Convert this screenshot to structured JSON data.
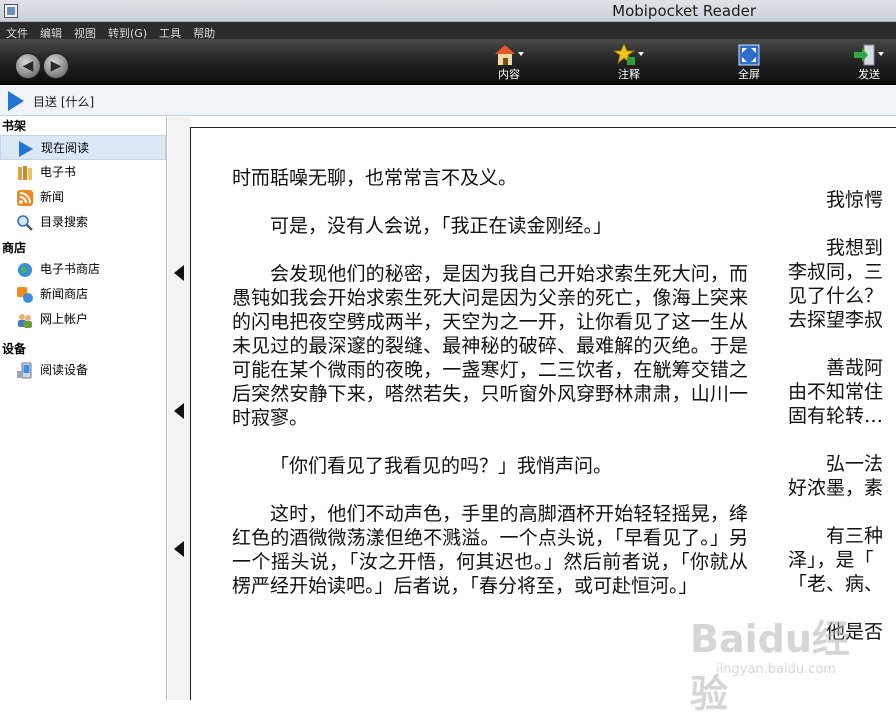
{
  "window": {
    "title": "Mobipocket Reader"
  },
  "menu": [
    "文件",
    "编辑",
    "视图",
    "转到(G)",
    "工具",
    "帮助"
  ],
  "toolbar": {
    "back_icon": "back-arrow-icon",
    "forward_icon": "forward-arrow-icon",
    "tools": [
      {
        "label": "内容",
        "icon": "home-icon"
      },
      {
        "label": "注释",
        "icon": "star-icon"
      },
      {
        "label": "全屏",
        "icon": "fullscreen-icon"
      },
      {
        "label": "发送",
        "icon": "send-icon"
      }
    ]
  },
  "breadcrumb": {
    "text": "目送 [什么]"
  },
  "sidebar": {
    "sections": [
      {
        "title": "书架",
        "items": [
          {
            "label": "现在阅读",
            "icon": "play-icon",
            "selected": true
          },
          {
            "label": "电子书",
            "icon": "books-icon"
          },
          {
            "label": "新闻",
            "icon": "rss-icon"
          },
          {
            "label": "目录搜索",
            "icon": "search-icon"
          }
        ]
      },
      {
        "title": "商店",
        "items": [
          {
            "label": "电子书商店",
            "icon": "globe-icon"
          },
          {
            "label": "新闻商店",
            "icon": "news-store-icon"
          },
          {
            "label": "网上帐户",
            "icon": "users-icon"
          }
        ]
      },
      {
        "title": "设备",
        "items": [
          {
            "label": "阅读设备",
            "icon": "device-icon"
          }
        ]
      }
    ]
  },
  "reader": {
    "column1": [
      "时而聒噪无聊，也常常言不及义。",
      "可是，没有人会说，「我正在读金刚经。」",
      "会发现他们的秘密，是因为我自己开始求索生死大问，而愚钝如我会开始求索生死大问是因为父亲的死亡，像海上突来的闪电把夜空劈成两半，天空为之一开，让你看见了这一生从未见过的最深邃的裂缝、最神秘的破碎、最难解的灭绝。于是可能在某个微雨的夜晚，一盏寒灯，二三饮者，在觥筹交错之后突然安静下来，嗒然若失，只听窗外风穿野林肃肃，山川一时寂寥。",
      "「你们看见了我看见的吗？」我悄声问。",
      "这时，他们不动声色，手里的高脚酒杯开始轻轻摇晃，绛红色的酒微微荡漾但绝不溅溢。一个点头说，「早看见了。」另一个摇头说，「汝之开悟，何其迟也。」然后前者说，「你就从楞严经开始读吧。」后者说，「春分将至，或可赴恒河。」"
    ],
    "column2": [
      [
        "我惊愕"
      ],
      [
        "我想到",
        "李叔同，三",
        "见了什么？",
        "去探望李叔"
      ],
      [
        "善哉阿",
        "由不知常住",
        "固有轮转…"
      ],
      [
        "弘一法",
        "好浓墨，素"
      ],
      [
        "有三种",
        "泽」，是「",
        "「老、病、"
      ],
      [
        "他是否"
      ]
    ]
  },
  "watermark": {
    "logo": "Baidu经验",
    "url": "jingyan.baidu.com"
  }
}
